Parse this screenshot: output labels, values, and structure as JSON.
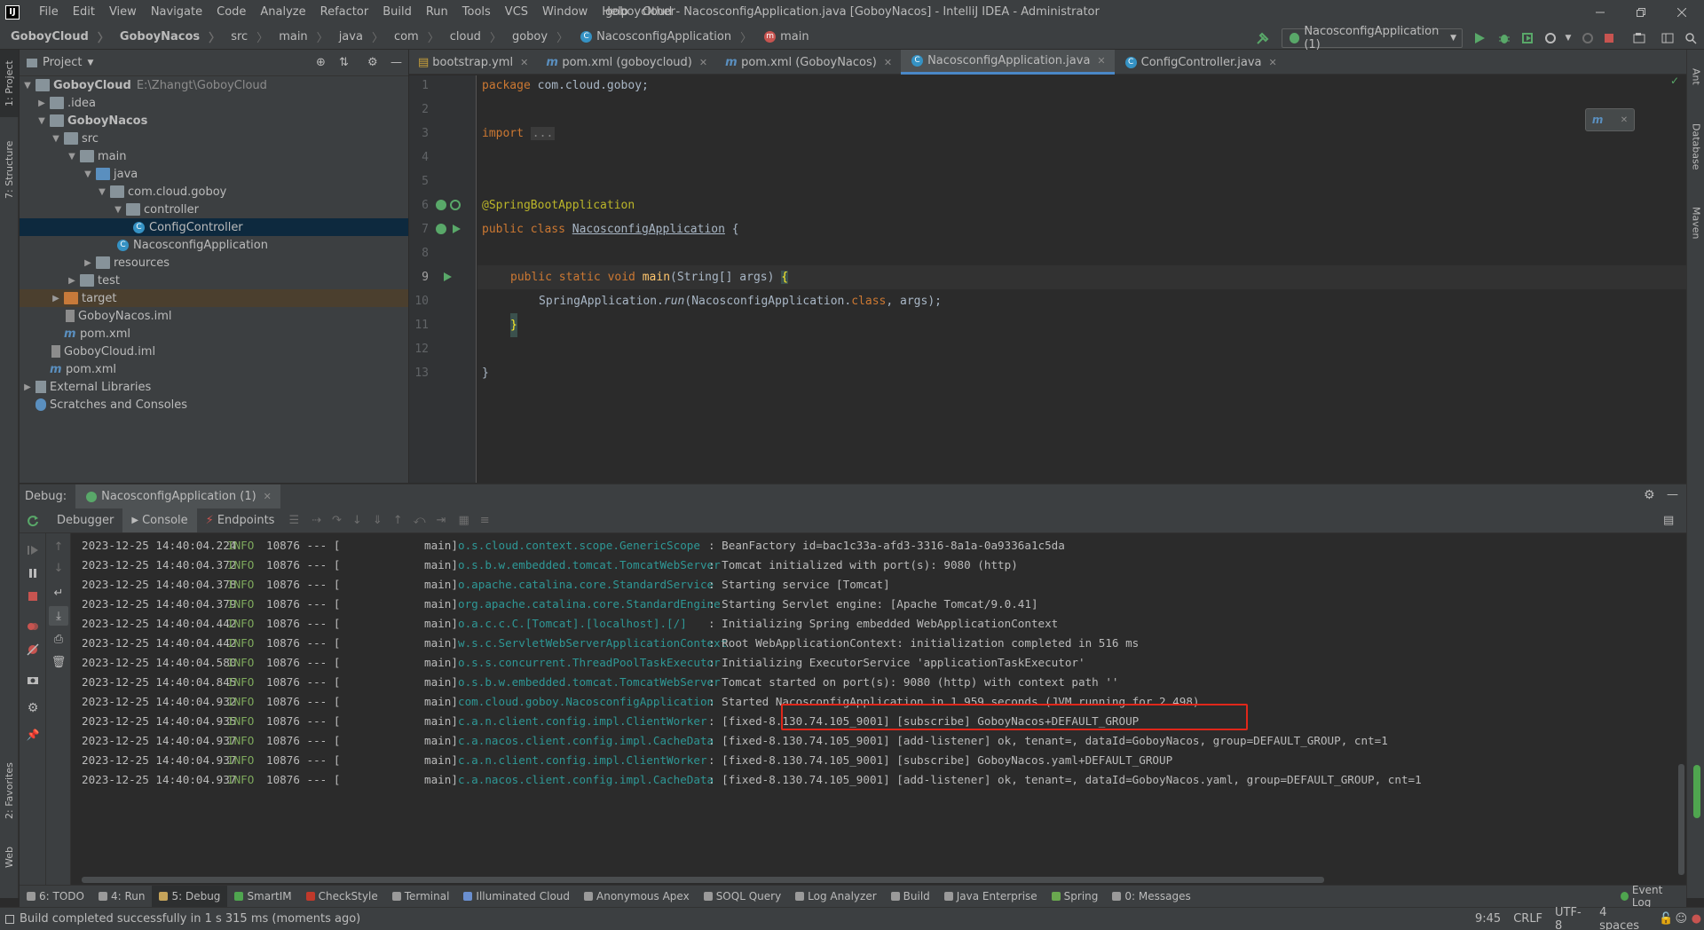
{
  "window": {
    "title": "goboycloud - NacosconfigApplication.java [GoboyNacos] - IntelliJ IDEA - Administrator",
    "menu": [
      "File",
      "Edit",
      "View",
      "Navigate",
      "Code",
      "Analyze",
      "Refactor",
      "Build",
      "Run",
      "Tools",
      "VCS",
      "Window",
      "Help",
      "Other"
    ]
  },
  "breadcrumbs": [
    "GoboyCloud",
    "GoboyNacos",
    "src",
    "main",
    "java",
    "com",
    "cloud",
    "goboy",
    "NacosconfigApplication",
    "main"
  ],
  "run_config": "NacosconfigApplication (1)",
  "left_stripe": [
    "1: Project",
    "7: Structure",
    "2: Favorites",
    "Web"
  ],
  "right_stripe": [
    "Ant",
    "Database",
    "Maven"
  ],
  "project": {
    "title": "Project",
    "tree": [
      {
        "label": "GoboyCloud",
        "extra": "E:\\Zhangt\\GoboyCloud",
        "bold": true
      },
      {
        "label": ".idea"
      },
      {
        "label": "GoboyNacos",
        "bold": true
      },
      {
        "label": "src"
      },
      {
        "label": "main"
      },
      {
        "label": "java"
      },
      {
        "label": "com.cloud.goboy"
      },
      {
        "label": "controller"
      },
      {
        "label": "ConfigController"
      },
      {
        "label": "NacosconfigApplication"
      },
      {
        "label": "resources"
      },
      {
        "label": "test"
      },
      {
        "label": "target"
      },
      {
        "label": "GoboyNacos.iml"
      },
      {
        "label": "pom.xml"
      },
      {
        "label": "GoboyCloud.iml"
      },
      {
        "label": "pom.xml"
      },
      {
        "label": "External Libraries"
      },
      {
        "label": "Scratches and Consoles"
      }
    ]
  },
  "editor": {
    "tabs": [
      "bootstrap.yml",
      "pom.xml (goboycloud)",
      "pom.xml (GoboyNacos)",
      "NacosconfigApplication.java",
      "ConfigController.java"
    ],
    "active_tab": "NacosconfigApplication.java",
    "line_numbers": [
      "1",
      "2",
      "3",
      "4",
      "5",
      "6",
      "7",
      "8",
      "9",
      "10",
      "11",
      "12",
      "13"
    ],
    "code": {
      "l1_kw": "package",
      "l1_rest": " com.cloud.goboy;",
      "l3_kw": "import",
      "l3_fold": "...",
      "l6": "@SpringBootApplication",
      "l7_kw": "public class",
      "l7_name": "NacosconfigApplication",
      "l7_rest": " {",
      "l9_kw": "public static void",
      "l9_fn": "main",
      "l9_rest": "(String[] args) ",
      "l9_brace": "{",
      "l10_a": "SpringApplication.",
      "l10_run": "run",
      "l10_b": "(NacosconfigApplication.",
      "l10_kw": "class",
      "l10_c": ", args);",
      "l11": "}",
      "l13": "}"
    }
  },
  "debug": {
    "label": "Debug:",
    "session": "NacosconfigApplication (1)",
    "tabs": [
      "Debugger",
      "Console",
      "Endpoints"
    ],
    "active_tab": "Console",
    "log": [
      {
        "ts": "2023-12-25 14:40:04.224",
        "level": "INFO",
        "pid": "10876 --- [",
        "thread": "main]",
        "logger": "o.s.cloud.context.scope.GenericScope",
        "msg": ": BeanFactory id=bac1c33a-afd3-3316-8a1a-0a9336a1c5da"
      },
      {
        "ts": "2023-12-25 14:40:04.372",
        "level": "INFO",
        "pid": "10876 --- [",
        "thread": "main]",
        "logger": "o.s.b.w.embedded.tomcat.TomcatWebServer",
        "msg": ": Tomcat initialized with port(s): 9080 (http)"
      },
      {
        "ts": "2023-12-25 14:40:04.378",
        "level": "INFO",
        "pid": "10876 --- [",
        "thread": "main]",
        "logger": "o.apache.catalina.core.StandardService",
        "msg": ": Starting service [Tomcat]"
      },
      {
        "ts": "2023-12-25 14:40:04.379",
        "level": "INFO",
        "pid": "10876 --- [",
        "thread": "main]",
        "logger": "org.apache.catalina.core.StandardEngine",
        "msg": ": Starting Servlet engine: [Apache Tomcat/9.0.41]"
      },
      {
        "ts": "2023-12-25 14:40:04.442",
        "level": "INFO",
        "pid": "10876 --- [",
        "thread": "main]",
        "logger": "o.a.c.c.C.[Tomcat].[localhost].[/]",
        "msg": ": Initializing Spring embedded WebApplicationContext"
      },
      {
        "ts": "2023-12-25 14:40:04.442",
        "level": "INFO",
        "pid": "10876 --- [",
        "thread": "main]",
        "logger": "w.s.c.ServletWebServerApplicationContext",
        "msg": ": Root WebApplicationContext: initialization completed in 516 ms"
      },
      {
        "ts": "2023-12-25 14:40:04.580",
        "level": "INFO",
        "pid": "10876 --- [",
        "thread": "main]",
        "logger": "o.s.s.concurrent.ThreadPoolTaskExecutor",
        "msg": ": Initializing ExecutorService 'applicationTaskExecutor'"
      },
      {
        "ts": "2023-12-25 14:40:04.845",
        "level": "INFO",
        "pid": "10876 --- [",
        "thread": "main]",
        "logger": "o.s.b.w.embedded.tomcat.TomcatWebServer",
        "msg": ": Tomcat started on port(s): 9080 (http) with context path ''"
      },
      {
        "ts": "2023-12-25 14:40:04.932",
        "level": "INFO",
        "pid": "10876 --- [",
        "thread": "main]",
        "logger": "com.cloud.goboy.NacosconfigApplication",
        "msg": ": Started NacosconfigApplication in 1.959 seconds (JVM running for 2.498)"
      },
      {
        "ts": "2023-12-25 14:40:04.935",
        "level": "INFO",
        "pid": "10876 --- [",
        "thread": "main]",
        "logger": "c.a.n.client.config.impl.ClientWorker",
        "msg": ": [fixed-8.130.74.105_9001] [subscribe] GoboyNacos+DEFAULT_GROUP"
      },
      {
        "ts": "2023-12-25 14:40:04.937",
        "level": "INFO",
        "pid": "10876 --- [",
        "thread": "main]",
        "logger": "c.a.nacos.client.config.impl.CacheData",
        "msg": ": [fixed-8.130.74.105_9001] [add-listener] ok, tenant=, dataId=GoboyNacos, group=DEFAULT_GROUP, cnt=1"
      },
      {
        "ts": "2023-12-25 14:40:04.937",
        "level": "INFO",
        "pid": "10876 --- [",
        "thread": "main]",
        "logger": "c.a.n.client.config.impl.ClientWorker",
        "msg": ": [fixed-8.130.74.105_9001] [subscribe] GoboyNacos.yaml+DEFAULT_GROUP"
      },
      {
        "ts": "2023-12-25 14:40:04.937",
        "level": "INFO",
        "pid": "10876 --- [",
        "thread": "main]",
        "logger": "c.a.nacos.client.config.impl.CacheData",
        "msg": ": [fixed-8.130.74.105_9001] [add-listener] ok, tenant=, dataId=GoboyNacos.yaml, group=DEFAULT_GROUP, cnt=1"
      }
    ]
  },
  "tool_windows": [
    {
      "label": "6: TODO",
      "color": "#9a9a9a"
    },
    {
      "label": "4: Run",
      "color": "#9a9a9a"
    },
    {
      "label": "5: Debug",
      "color": "#c5a35a"
    },
    {
      "label": "SmartIM",
      "color": "#4fa54f"
    },
    {
      "label": "CheckStyle",
      "color": "#c0392b"
    },
    {
      "label": "Terminal",
      "color": "#9a9a9a"
    },
    {
      "label": "Illuminated Cloud",
      "color": "#6a8fd0"
    },
    {
      "label": "Anonymous Apex",
      "color": "#9a9a9a"
    },
    {
      "label": "SOQL Query",
      "color": "#9a9a9a"
    },
    {
      "label": "Log Analyzer",
      "color": "#9a9a9a"
    },
    {
      "label": "Build",
      "color": "#9a9a9a"
    },
    {
      "label": "Java Enterprise",
      "color": "#9a9a9a"
    },
    {
      "label": "Spring",
      "color": "#6aa84f"
    },
    {
      "label": "0: Messages",
      "color": "#9a9a9a"
    }
  ],
  "event_log": "Event Log",
  "status": {
    "message": "Build completed successfully in 1 s 315 ms (moments ago)",
    "position": "9:45",
    "line_sep": "CRLF",
    "encoding": "UTF-8",
    "indent": "4 spaces"
  },
  "colors": {
    "accent": "#4a88c7",
    "highlight_box": "#e0271a",
    "run_green": "#59a869",
    "stop_red": "#c75450"
  }
}
